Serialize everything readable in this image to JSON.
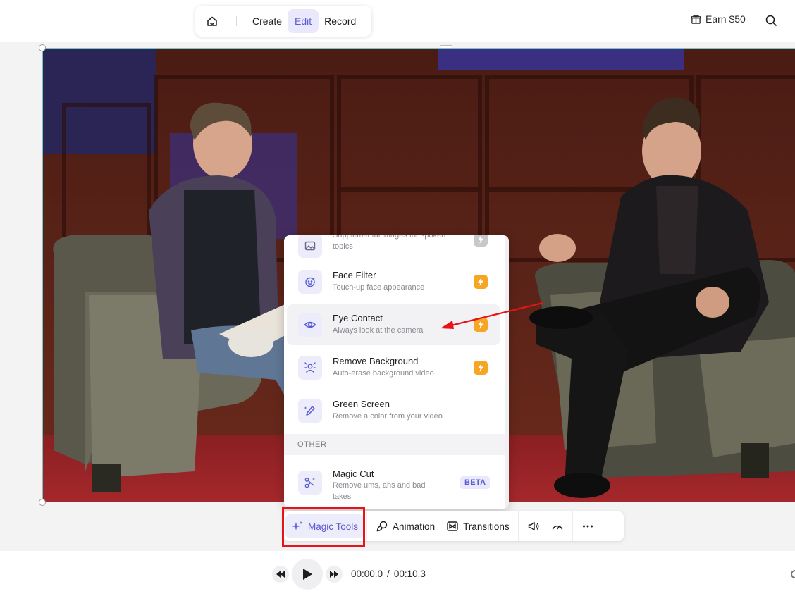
{
  "topbar": {
    "home_icon": "home-icon",
    "modes": [
      {
        "label": "Create",
        "active": false
      },
      {
        "label": "Edit",
        "active": true
      },
      {
        "label": "Record",
        "active": false
      }
    ],
    "earn_label": "Earn $50",
    "earn_icon": "gift-icon",
    "search_icon": "search-icon"
  },
  "magic_menu": {
    "items": [
      {
        "title": "",
        "subtitle": "Supplemental images for spoken topics",
        "icon": "image-icon",
        "badge": "bolt-gray"
      },
      {
        "title": "Face Filter",
        "subtitle": "Touch-up face appearance",
        "icon": "face-sparkle-icon",
        "badge": "bolt"
      },
      {
        "title": "Eye Contact",
        "subtitle": "Always look at the camera",
        "icon": "eye-icon",
        "badge": "bolt"
      },
      {
        "title": "Remove Background",
        "subtitle": "Auto-erase background video",
        "icon": "person-erase-icon",
        "badge": "bolt"
      },
      {
        "title": "Green Screen",
        "subtitle": "Remove a color from your video",
        "icon": "eyedropper-icon",
        "badge": ""
      }
    ],
    "section_label": "OTHER",
    "other_items": [
      {
        "title": "Magic Cut",
        "subtitle": "Remove ums, ahs and bad takes",
        "icon": "scissors-sparkle-icon",
        "badge_text": "BETA"
      }
    ]
  },
  "toolbar": {
    "magic_tools_label": "Magic Tools",
    "animation_label": "Animation",
    "transitions_label": "Transitions",
    "icons": [
      "sparkle-icon",
      "animation-icon",
      "transitions-icon",
      "volume-icon",
      "speed-icon",
      "more-icon"
    ]
  },
  "player": {
    "current_time": "00:00.0",
    "separator": "/",
    "total_time": "00:10.3"
  },
  "colors": {
    "accent": "#5b5bd6",
    "accent_bg": "#ececfb",
    "bolt": "#f6a623",
    "annotation_red": "#e8121a"
  }
}
